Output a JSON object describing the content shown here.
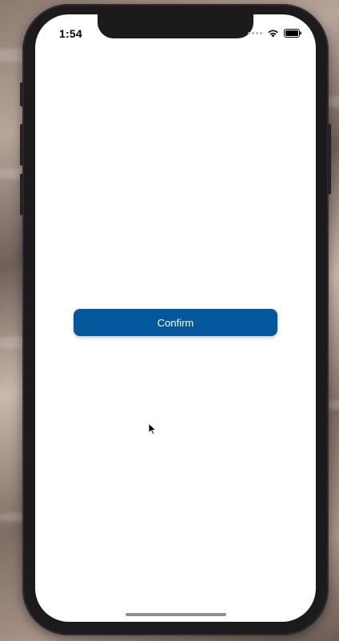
{
  "status_bar": {
    "time": "1:54",
    "icons": [
      "cellular-signal-icon",
      "wifi-icon",
      "battery-icon"
    ]
  },
  "main": {
    "confirm_label": "Confirm"
  },
  "colors": {
    "confirm_button": "#03579b",
    "screen_background": "#ffffff",
    "device_frame": "#1b1b1d"
  }
}
